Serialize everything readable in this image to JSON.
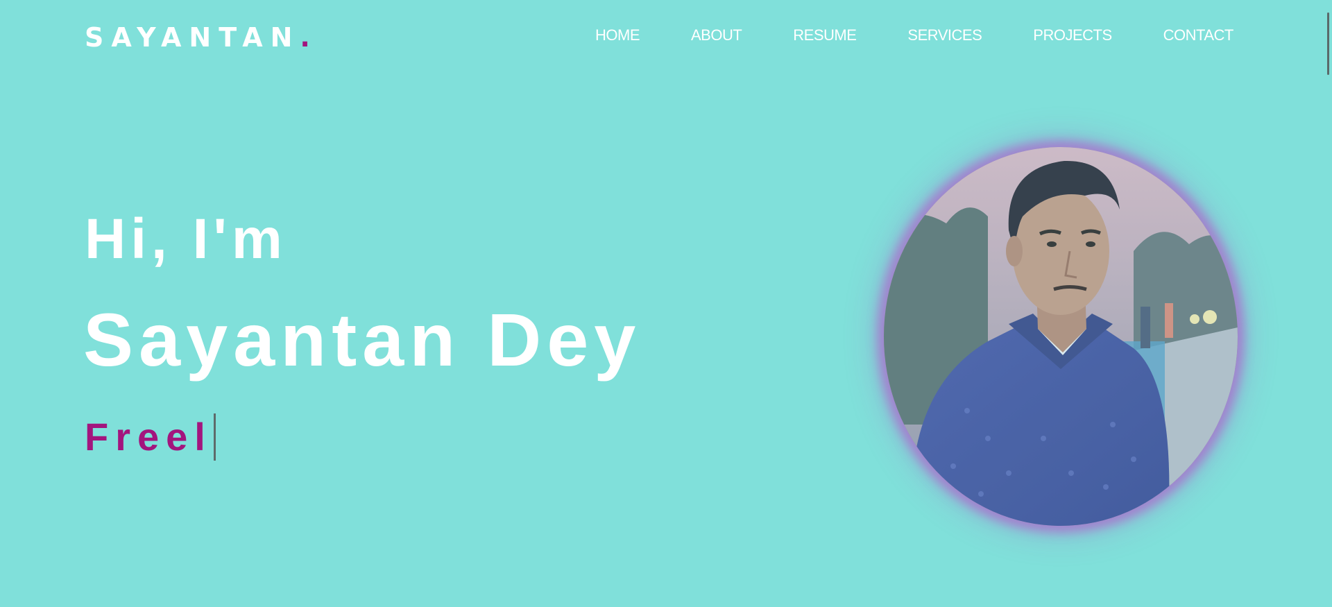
{
  "header": {
    "logo_text": "SAYANTAN",
    "logo_dot": ".",
    "nav": [
      {
        "label": "HOME"
      },
      {
        "label": "ABOUT"
      },
      {
        "label": "RESUME"
      },
      {
        "label": "SERVICES"
      },
      {
        "label": "PROJECTS"
      },
      {
        "label": "CONTACT"
      }
    ]
  },
  "hero": {
    "greeting": "Hi, I'm",
    "name": "Sayantan Dey",
    "typed_text": "Freel"
  },
  "colors": {
    "background": "#80e0da",
    "accent": "#a3157e",
    "text": "#ffffff"
  }
}
